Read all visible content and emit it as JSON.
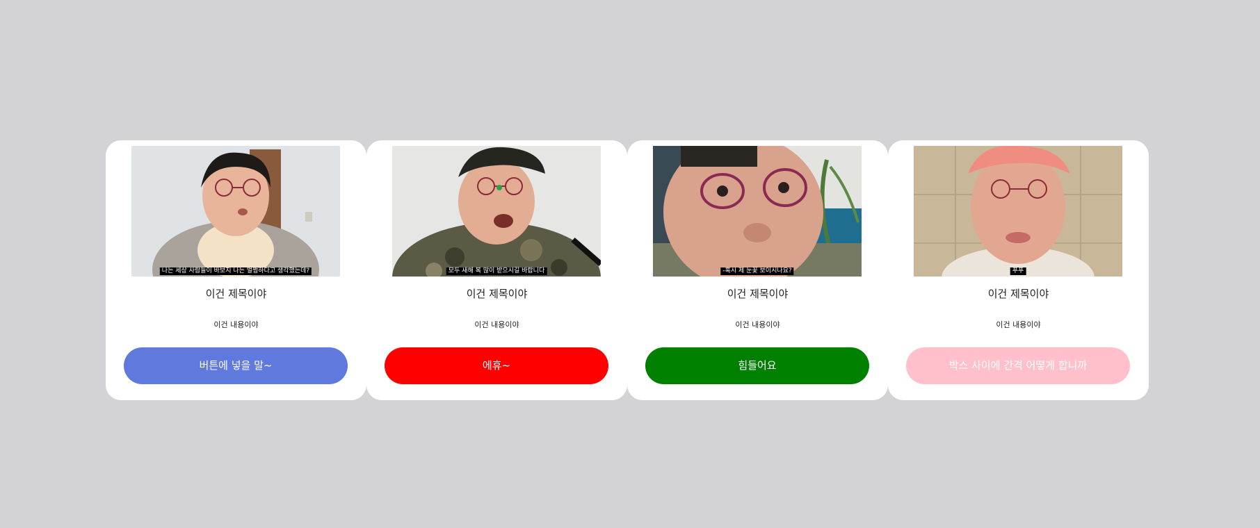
{
  "cards": [
    {
      "caption": "나는 세상 사람들이 바보지 나는 멀쩡하다고 생각했는데?",
      "title": "이건 제목이야",
      "body": "이건 내용이야",
      "button_label": "버튼에 넣을 말~",
      "button_color": "#6079dc",
      "photo_bg": "#dfe3e6",
      "photo_desc": "man in grey hoodie with glasses"
    },
    {
      "caption": "모두 새해 복 많이 받으시길 바랍니다",
      "title": "이건 제목이야",
      "body": "이건 내용이야",
      "button_label": "에휴~",
      "button_color": "#ff0000",
      "photo_bg": "#e6e6e4",
      "photo_desc": "man in camouflage uniform with beret"
    },
    {
      "caption": "-혹시 제 눈꽃 보이시나요?",
      "title": "이건 제목이야",
      "body": "이건 내용이야",
      "button_label": "힘들어요",
      "button_color": "#008000",
      "photo_bg": "#3a4a55",
      "photo_desc": "close-up face with glasses"
    },
    {
      "caption": "푸푸",
      "title": "이건 제목이야",
      "body": "이건 내용이야",
      "button_label": "박스 사이에 간격 어떻게 합니까",
      "button_color": "#ffc0cb",
      "photo_bg": "#c9b79a",
      "photo_desc": "man with pink headband and glasses"
    }
  ]
}
